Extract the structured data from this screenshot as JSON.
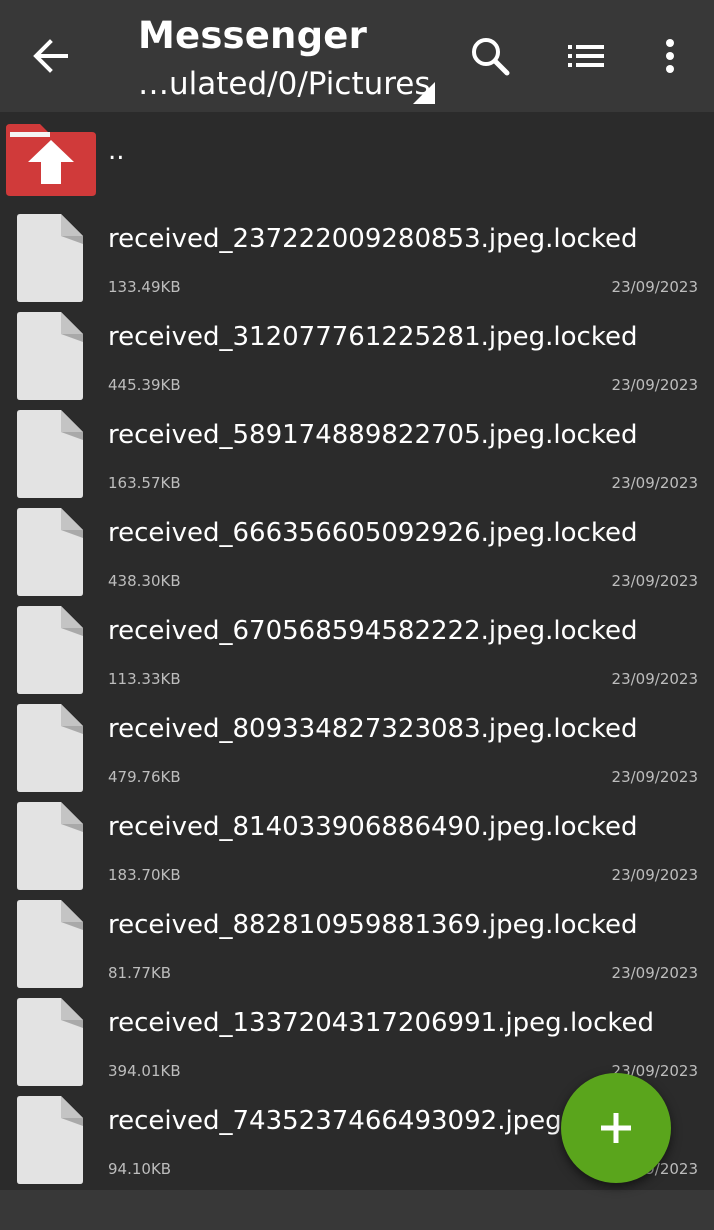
{
  "appbar": {
    "title": "Messenger",
    "path": "…ulated/0/Pictures",
    "icons": {
      "back": "arrow-left-icon",
      "search": "search-icon",
      "view": "list-view-icon",
      "more": "more-vert-icon"
    }
  },
  "up": {
    "label": "..",
    "icon": "folder-up-icon"
  },
  "files": [
    {
      "name": "received_237222009280853.jpeg.locked",
      "size": "133.49KB",
      "date": "23/09/2023"
    },
    {
      "name": "received_312077761225281.jpeg.locked",
      "size": "445.39KB",
      "date": "23/09/2023"
    },
    {
      "name": "received_589174889822705.jpeg.locked",
      "size": "163.57KB",
      "date": "23/09/2023"
    },
    {
      "name": "received_666356605092926.jpeg.locked",
      "size": "438.30KB",
      "date": "23/09/2023"
    },
    {
      "name": "received_670568594582222.jpeg.locked",
      "size": "113.33KB",
      "date": "23/09/2023"
    },
    {
      "name": "received_809334827323083.jpeg.locked",
      "size": "479.76KB",
      "date": "23/09/2023"
    },
    {
      "name": "received_814033906886490.jpeg.locked",
      "size": "183.70KB",
      "date": "23/09/2023"
    },
    {
      "name": "received_882810959881369.jpeg.locked",
      "size": "81.77KB",
      "date": "23/09/2023"
    },
    {
      "name": "received_1337204317206991.jpeg.locked",
      "size": "394.01KB",
      "date": "23/09/2023"
    },
    {
      "name": "received_7435237466493092.jpeg.locked",
      "size": "94.10KB",
      "date": "23/09/2023"
    }
  ],
  "fab": {
    "icon": "plus-icon"
  },
  "colors": {
    "appbar": "#383838",
    "background": "#2b2b2b",
    "fab": "#5aa51c",
    "folder": "#d03a3a"
  }
}
